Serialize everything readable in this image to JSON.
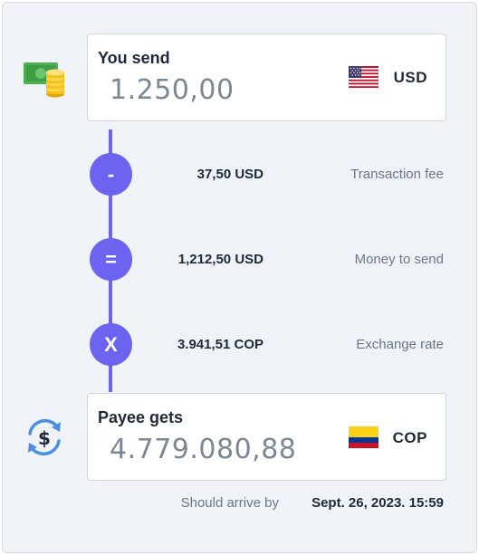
{
  "send": {
    "label": "You send",
    "amount": "1.250,00",
    "currency": "USD"
  },
  "breakdown": [
    {
      "symbol": "-",
      "value": "37,50 USD",
      "label": "Transaction fee"
    },
    {
      "symbol": "=",
      "value": "1,212,50 USD",
      "label": "Money to send"
    },
    {
      "symbol": "X",
      "value": "3.941,51 COP",
      "label": "Exchange rate"
    }
  ],
  "receive": {
    "label": "Payee gets",
    "amount": "4.779.080,88",
    "currency": "COP"
  },
  "arrival": {
    "label": "Should arrive by",
    "date": "Sept. 26, 2023. 15:59"
  },
  "icons": {
    "send": "cash-coins-icon",
    "receive": "currency-exchange-icon"
  },
  "colors": {
    "accent": "#6c63f0",
    "background": "#eff2f6",
    "text_dark": "#1e2a3a",
    "text_muted": "#6b7785"
  }
}
